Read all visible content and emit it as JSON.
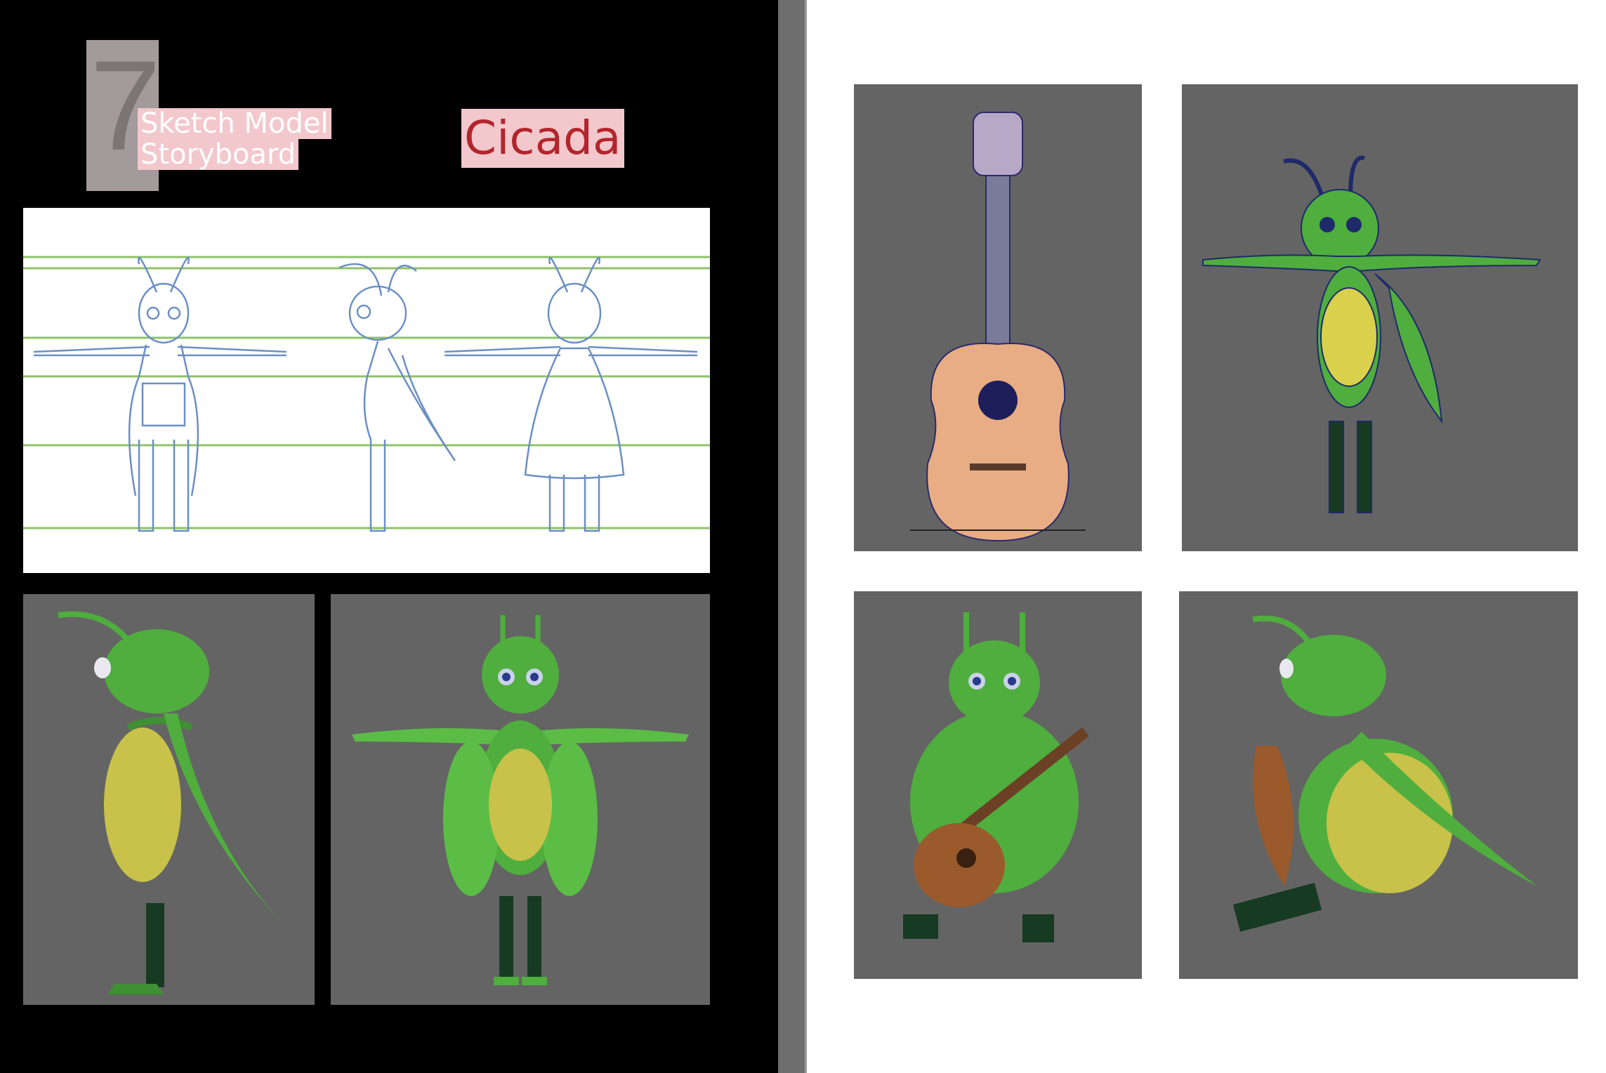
{
  "page_number": "7",
  "subtitle": {
    "line1": "Sketch Model",
    "line2": "Storyboard"
  },
  "title": "Cicada",
  "colors": {
    "page_left": "#000000",
    "viewport_bg": "#646464",
    "highlight": "#f2c8cc",
    "title_text": "#b3252c",
    "body_green": "#4fae3e",
    "belly_yellow": "#c8c24a",
    "boot_dark": "#173a22",
    "guitar_wood": "#9a5a2c",
    "sketch_line": "#6b8fc4",
    "guide_line": "#8fc26a"
  },
  "images": [
    {
      "name": "sketch-turnaround",
      "content": "character turnaround sketch: front, side, back"
    },
    {
      "name": "render-side",
      "content": "cicada 3D render side view"
    },
    {
      "name": "render-front",
      "content": "cicada 3D render front T-pose"
    },
    {
      "name": "guitar-wireframe",
      "content": "guitar wireframe model"
    },
    {
      "name": "cicada-wireframe",
      "content": "cicada wireframe T-pose"
    },
    {
      "name": "render-playing-front",
      "content": "cicada sitting playing guitar front"
    },
    {
      "name": "render-playing-side",
      "content": "cicada sitting playing guitar side"
    }
  ]
}
